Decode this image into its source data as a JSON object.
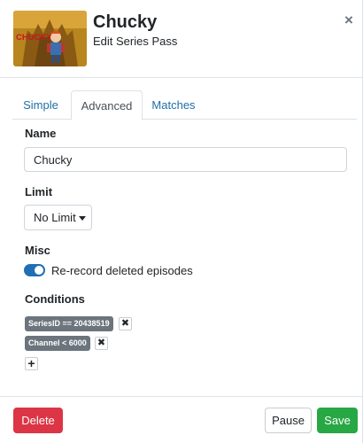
{
  "header": {
    "title": "Chucky",
    "subtitle": "Edit Series Pass",
    "thumbnail_text": "CHUCKY",
    "close_label": "×"
  },
  "tabs": [
    {
      "label": "Simple",
      "active": false
    },
    {
      "label": "Advanced",
      "active": true
    },
    {
      "label": "Matches",
      "active": false
    }
  ],
  "form": {
    "name_label": "Name",
    "name_value": "Chucky",
    "limit_label": "Limit",
    "limit_value": "No Limit",
    "misc_label": "Misc",
    "rerecord_label": "Re-record deleted episodes",
    "rerecord_enabled": true,
    "conditions_label": "Conditions",
    "conditions": [
      {
        "text": "SeriesID == 20438519"
      },
      {
        "text": "Channel < 6000"
      }
    ],
    "remove_label": "✖",
    "add_label": "+"
  },
  "footer": {
    "delete_label": "Delete",
    "pause_label": "Pause",
    "save_label": "Save"
  },
  "colors": {
    "accent": "#1f6fb5",
    "danger": "#dc3545",
    "success": "#28a745",
    "badge": "#6c757d"
  }
}
